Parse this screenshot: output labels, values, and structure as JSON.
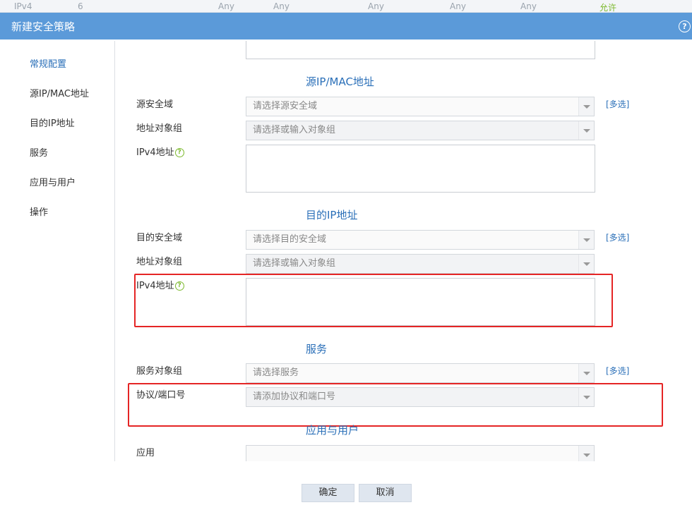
{
  "background_row": {
    "protocol": "IPv4",
    "number": "6",
    "cols": [
      "Any",
      "Any",
      "Any",
      "Any",
      "Any"
    ],
    "action": "允许"
  },
  "dialog": {
    "title": "新建安全策略",
    "help_icon": "question-circle-icon"
  },
  "sidebar": {
    "items": [
      {
        "label": "常规配置",
        "active": true
      },
      {
        "label": "源IP/MAC地址",
        "active": false
      },
      {
        "label": "目的IP地址",
        "active": false
      },
      {
        "label": "服务",
        "active": false
      },
      {
        "label": "应用与用户",
        "active": false
      },
      {
        "label": "操作",
        "active": false
      }
    ]
  },
  "source_section": {
    "title": "源IP/MAC地址",
    "zone_label": "源安全域",
    "zone_placeholder": "请选择源安全域",
    "zone_multi": "[多选]",
    "addr_group_label": "地址对象组",
    "addr_group_placeholder": "请选择或输入对象组",
    "ipv4_label": "IPv4地址"
  },
  "dest_section": {
    "title": "目的IP地址",
    "zone_label": "目的安全域",
    "zone_placeholder": "请选择目的安全域",
    "zone_multi": "[多选]",
    "addr_group_label": "地址对象组",
    "addr_group_placeholder": "请选择或输入对象组",
    "ipv4_label": "IPv4地址"
  },
  "service_section": {
    "title": "服务",
    "group_label": "服务对象组",
    "group_placeholder": "请选择服务",
    "group_multi": "[多选]",
    "proto_label": "协议/端口号",
    "proto_placeholder": "请添加协议和端口号"
  },
  "app_section": {
    "title": "应用与用户",
    "app_label": "应用"
  },
  "footer": {
    "ok": "确定",
    "cancel": "取消"
  },
  "colors": {
    "titlebar": "#5b9ad9",
    "accent": "#2a6fb8",
    "highlight": "#e52525"
  }
}
